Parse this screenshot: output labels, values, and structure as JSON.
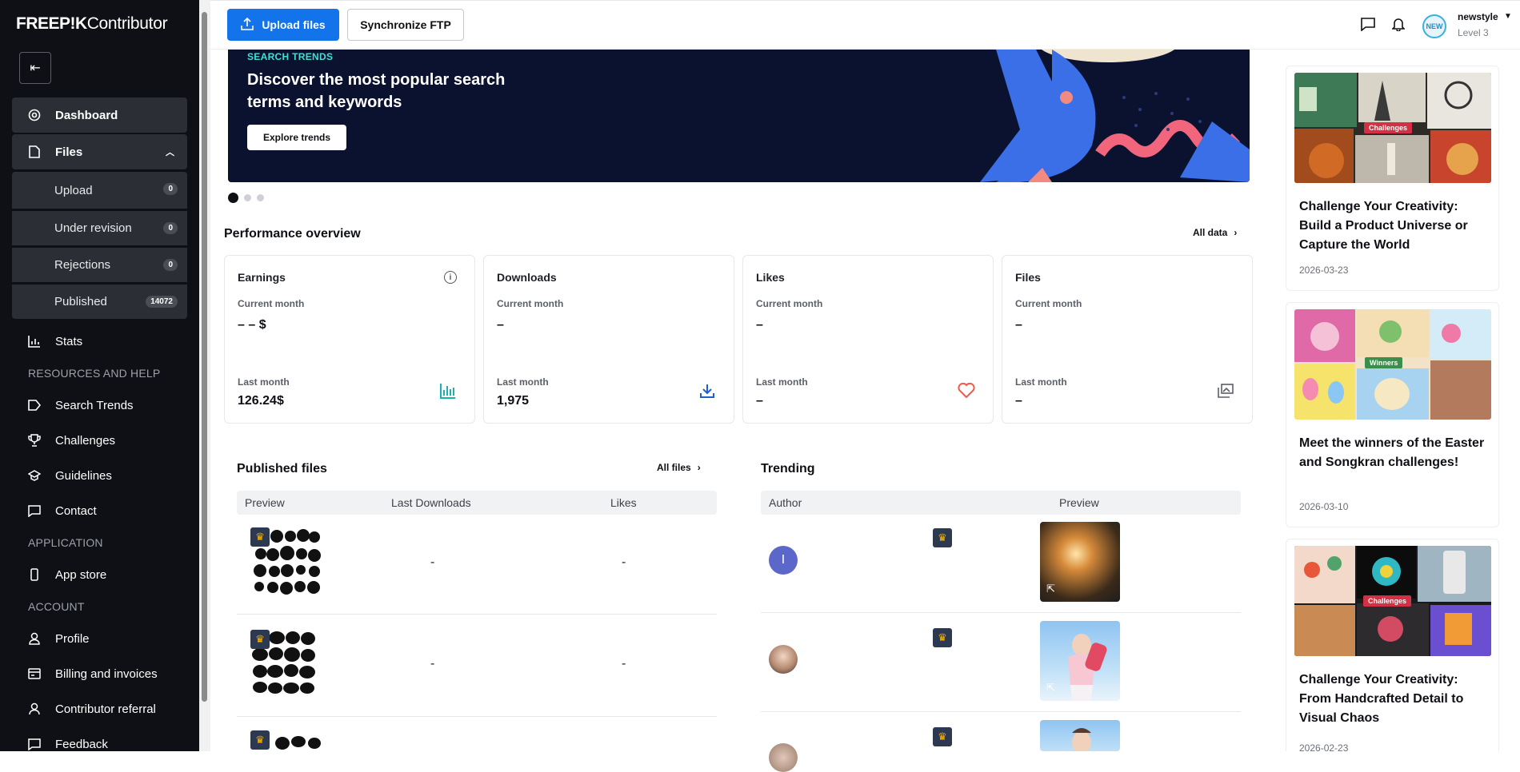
{
  "sidebar": {
    "logo_brand": "FREEP!K",
    "logo_product": "Contributor",
    "dashboard": "Dashboard",
    "files": "Files",
    "files_sub": [
      {
        "label": "Upload",
        "count": "0"
      },
      {
        "label": "Under revision",
        "count": "0"
      },
      {
        "label": "Rejections",
        "count": "0"
      },
      {
        "label": "Published",
        "count": "14072"
      }
    ],
    "stats": "Stats",
    "section_resources": "RESOURCES AND HELP",
    "search_trends": "Search Trends",
    "challenges": "Challenges",
    "guidelines": "Guidelines",
    "contact": "Contact",
    "section_application": "APPLICATION",
    "app_store": "App store",
    "section_account": "ACCOUNT",
    "profile": "Profile",
    "billing": "Billing and invoices",
    "referral": "Contributor referral",
    "feedback": "Feedback"
  },
  "topbar": {
    "upload_label": "Upload files",
    "ftp_label": "Synchronize FTP",
    "username": "newstyle",
    "level": "Level 3",
    "avatar_text": "NEW"
  },
  "banner": {
    "tag": "SEARCH TRENDS",
    "title": "Discover the most popular search terms and keywords",
    "button": "Explore trends"
  },
  "performance": {
    "title": "Performance overview",
    "all_data": "All data",
    "cards": [
      {
        "name": "Earnings",
        "current_label": "Current month",
        "current": "– – $",
        "last_label": "Last month",
        "last": "126.24$",
        "icon": "bar-chart-icon",
        "color": "#18b3b0"
      },
      {
        "name": "Downloads",
        "current_label": "Current month",
        "current": "–",
        "last_label": "Last month",
        "last": "1,975",
        "icon": "download-icon",
        "color": "#1f5fd1"
      },
      {
        "name": "Likes",
        "current_label": "Current month",
        "current": "–",
        "last_label": "Last month",
        "last": "–",
        "icon": "heart-icon",
        "color": "#ef5a4b"
      },
      {
        "name": "Files",
        "current_label": "Current month",
        "current": "–",
        "last_label": "Last month",
        "last": "–",
        "icon": "images-icon",
        "color": "#5b5f68"
      }
    ]
  },
  "published": {
    "title": "Published files",
    "all_files": "All files",
    "columns": [
      "Preview",
      "Last Downloads",
      "Likes"
    ],
    "rows": [
      {
        "downloads": "-",
        "likes": "-"
      },
      {
        "downloads": "-",
        "likes": "-"
      }
    ]
  },
  "trending": {
    "title": "Trending",
    "columns": [
      "Author",
      "Preview"
    ],
    "rows": [
      {
        "author_initial": "I"
      },
      {
        "author_initial": ""
      },
      {
        "author_initial": ""
      }
    ]
  },
  "news": [
    {
      "title": "Challenge Your Creativity: Build a Product Universe or Capture the World",
      "date": "2026-03-23",
      "chip": "Challenges"
    },
    {
      "title": "Meet the winners of the Easter and Songkran challenges!",
      "date": "2026-03-10",
      "chip": "Winners"
    },
    {
      "title": "Challenge Your Creativity: From Handcrafted Detail to Visual Chaos",
      "date": "2026-02-23",
      "chip": "Challenges"
    }
  ],
  "colors": {
    "accent": "#1273eb",
    "sidebar_bg": "#0e1015",
    "banner_bg": "#0b1230",
    "teal": "#3ee0d3"
  }
}
